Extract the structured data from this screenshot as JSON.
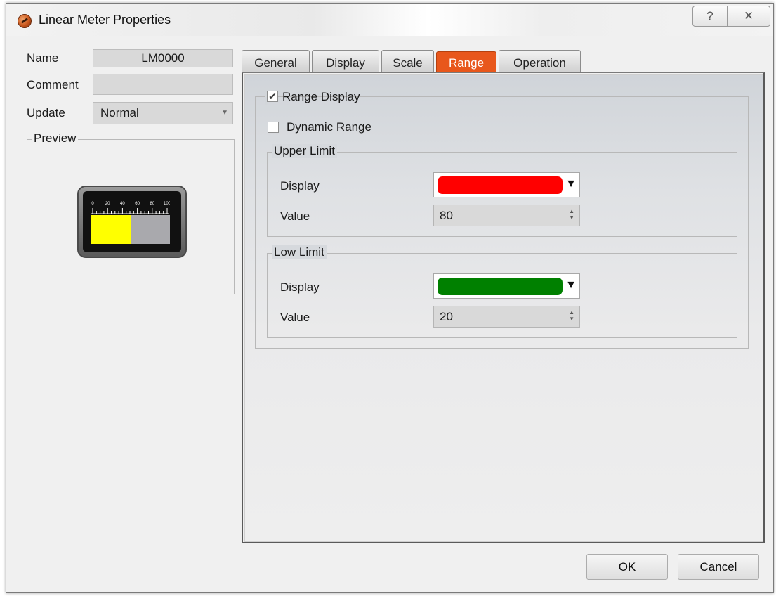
{
  "window": {
    "title": "Linear Meter Properties",
    "help_glyph": "?",
    "close_glyph": "✕"
  },
  "left": {
    "name_label": "Name",
    "name_value": "LM0000",
    "comment_label": "Comment",
    "comment_value": "",
    "update_label": "Update",
    "update_value": "Normal",
    "preview_label": "Preview",
    "meter": {
      "scale_labels": [
        "0",
        "20",
        "40",
        "60",
        "80",
        "100"
      ],
      "fill_fraction": 0.5,
      "fill_color": "#ffff00",
      "empty_color": "#a9a9ad"
    }
  },
  "tabs": [
    {
      "label": "General",
      "active": false
    },
    {
      "label": "Display",
      "active": false
    },
    {
      "label": "Scale",
      "active": false
    },
    {
      "label": "Range",
      "active": true
    },
    {
      "label": "Operation",
      "active": false
    }
  ],
  "range": {
    "range_display_label": "Range Display",
    "range_display_checked": true,
    "dynamic_range_label": "Dynamic Range",
    "dynamic_range_checked": false,
    "upper": {
      "title": "Upper Limit",
      "display_label": "Display",
      "display_color": "#ff0000",
      "value_label": "Value",
      "value": "80"
    },
    "low": {
      "title": "Low Limit",
      "display_label": "Display",
      "display_color": "#008000",
      "value_label": "Value",
      "value": "20"
    }
  },
  "buttons": {
    "ok": "OK",
    "cancel": "Cancel"
  },
  "colors": {
    "active_tab": "#e8571c"
  }
}
